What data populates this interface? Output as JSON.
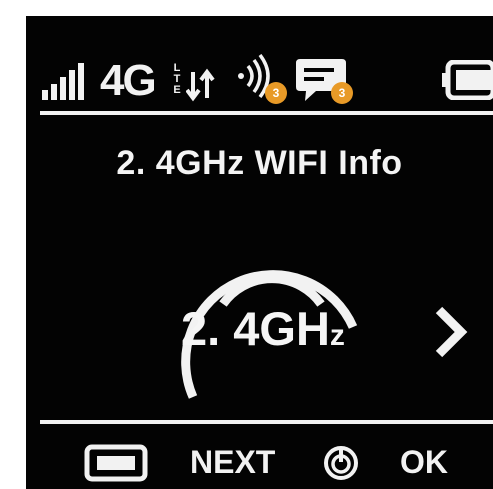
{
  "status_bar": {
    "network_type": "4G",
    "network_subtype": "LTE",
    "icons": [
      "signal-strength-icon",
      "4g-lte-icon",
      "data-transfer-icon",
      "wifi-broadcast-icon",
      "message-icon",
      "battery-icon"
    ],
    "wifi_badge_count": "3",
    "message_badge_count": "3",
    "badge_color": "#e89a27"
  },
  "screen": {
    "title": "2. 4GHz WIFI Info"
  },
  "band": {
    "label_main": "2. 4GH",
    "label_sub": "z"
  },
  "footer": {
    "next_label": "NEXT",
    "ok_label": "OK"
  },
  "colors": {
    "background": "#030303",
    "foreground": "#f2f2f2"
  }
}
